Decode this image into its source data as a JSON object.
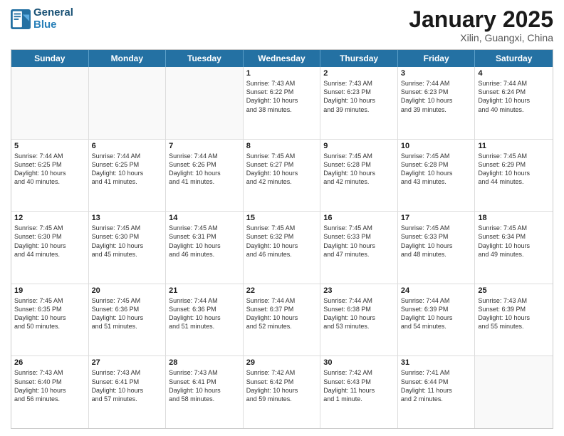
{
  "header": {
    "logo_line1": "General",
    "logo_line2": "Blue",
    "month": "January 2025",
    "location": "Xilin, Guangxi, China"
  },
  "weekdays": [
    "Sunday",
    "Monday",
    "Tuesday",
    "Wednesday",
    "Thursday",
    "Friday",
    "Saturday"
  ],
  "rows": [
    [
      {
        "day": "",
        "text": ""
      },
      {
        "day": "",
        "text": ""
      },
      {
        "day": "",
        "text": ""
      },
      {
        "day": "1",
        "text": "Sunrise: 7:43 AM\nSunset: 6:22 PM\nDaylight: 10 hours\nand 38 minutes."
      },
      {
        "day": "2",
        "text": "Sunrise: 7:43 AM\nSunset: 6:23 PM\nDaylight: 10 hours\nand 39 minutes."
      },
      {
        "day": "3",
        "text": "Sunrise: 7:44 AM\nSunset: 6:23 PM\nDaylight: 10 hours\nand 39 minutes."
      },
      {
        "day": "4",
        "text": "Sunrise: 7:44 AM\nSunset: 6:24 PM\nDaylight: 10 hours\nand 40 minutes."
      }
    ],
    [
      {
        "day": "5",
        "text": "Sunrise: 7:44 AM\nSunset: 6:25 PM\nDaylight: 10 hours\nand 40 minutes."
      },
      {
        "day": "6",
        "text": "Sunrise: 7:44 AM\nSunset: 6:25 PM\nDaylight: 10 hours\nand 41 minutes."
      },
      {
        "day": "7",
        "text": "Sunrise: 7:44 AM\nSunset: 6:26 PM\nDaylight: 10 hours\nand 41 minutes."
      },
      {
        "day": "8",
        "text": "Sunrise: 7:45 AM\nSunset: 6:27 PM\nDaylight: 10 hours\nand 42 minutes."
      },
      {
        "day": "9",
        "text": "Sunrise: 7:45 AM\nSunset: 6:28 PM\nDaylight: 10 hours\nand 42 minutes."
      },
      {
        "day": "10",
        "text": "Sunrise: 7:45 AM\nSunset: 6:28 PM\nDaylight: 10 hours\nand 43 minutes."
      },
      {
        "day": "11",
        "text": "Sunrise: 7:45 AM\nSunset: 6:29 PM\nDaylight: 10 hours\nand 44 minutes."
      }
    ],
    [
      {
        "day": "12",
        "text": "Sunrise: 7:45 AM\nSunset: 6:30 PM\nDaylight: 10 hours\nand 44 minutes."
      },
      {
        "day": "13",
        "text": "Sunrise: 7:45 AM\nSunset: 6:30 PM\nDaylight: 10 hours\nand 45 minutes."
      },
      {
        "day": "14",
        "text": "Sunrise: 7:45 AM\nSunset: 6:31 PM\nDaylight: 10 hours\nand 46 minutes."
      },
      {
        "day": "15",
        "text": "Sunrise: 7:45 AM\nSunset: 6:32 PM\nDaylight: 10 hours\nand 46 minutes."
      },
      {
        "day": "16",
        "text": "Sunrise: 7:45 AM\nSunset: 6:33 PM\nDaylight: 10 hours\nand 47 minutes."
      },
      {
        "day": "17",
        "text": "Sunrise: 7:45 AM\nSunset: 6:33 PM\nDaylight: 10 hours\nand 48 minutes."
      },
      {
        "day": "18",
        "text": "Sunrise: 7:45 AM\nSunset: 6:34 PM\nDaylight: 10 hours\nand 49 minutes."
      }
    ],
    [
      {
        "day": "19",
        "text": "Sunrise: 7:45 AM\nSunset: 6:35 PM\nDaylight: 10 hours\nand 50 minutes."
      },
      {
        "day": "20",
        "text": "Sunrise: 7:45 AM\nSunset: 6:36 PM\nDaylight: 10 hours\nand 51 minutes."
      },
      {
        "day": "21",
        "text": "Sunrise: 7:44 AM\nSunset: 6:36 PM\nDaylight: 10 hours\nand 51 minutes."
      },
      {
        "day": "22",
        "text": "Sunrise: 7:44 AM\nSunset: 6:37 PM\nDaylight: 10 hours\nand 52 minutes."
      },
      {
        "day": "23",
        "text": "Sunrise: 7:44 AM\nSunset: 6:38 PM\nDaylight: 10 hours\nand 53 minutes."
      },
      {
        "day": "24",
        "text": "Sunrise: 7:44 AM\nSunset: 6:39 PM\nDaylight: 10 hours\nand 54 minutes."
      },
      {
        "day": "25",
        "text": "Sunrise: 7:43 AM\nSunset: 6:39 PM\nDaylight: 10 hours\nand 55 minutes."
      }
    ],
    [
      {
        "day": "26",
        "text": "Sunrise: 7:43 AM\nSunset: 6:40 PM\nDaylight: 10 hours\nand 56 minutes."
      },
      {
        "day": "27",
        "text": "Sunrise: 7:43 AM\nSunset: 6:41 PM\nDaylight: 10 hours\nand 57 minutes."
      },
      {
        "day": "28",
        "text": "Sunrise: 7:43 AM\nSunset: 6:41 PM\nDaylight: 10 hours\nand 58 minutes."
      },
      {
        "day": "29",
        "text": "Sunrise: 7:42 AM\nSunset: 6:42 PM\nDaylight: 10 hours\nand 59 minutes."
      },
      {
        "day": "30",
        "text": "Sunrise: 7:42 AM\nSunset: 6:43 PM\nDaylight: 11 hours\nand 1 minute."
      },
      {
        "day": "31",
        "text": "Sunrise: 7:41 AM\nSunset: 6:44 PM\nDaylight: 11 hours\nand 2 minutes."
      },
      {
        "day": "",
        "text": ""
      }
    ]
  ]
}
